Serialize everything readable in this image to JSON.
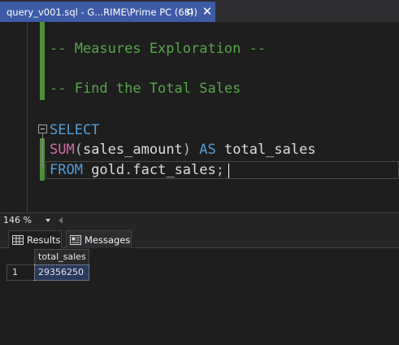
{
  "tab": {
    "title": "query_v001.sql - G...RIME\\Prime PC (68))",
    "pin_icon": "pin-icon",
    "close_icon": "close-icon"
  },
  "editor": {
    "lines": [
      {
        "segments": [
          {
            "text": "-- Measures Exploration --",
            "kind": "comment"
          }
        ]
      },
      {
        "segments": [
          {
            "text": "-- Find the Total Sales",
            "kind": "comment"
          }
        ]
      },
      {
        "segments": [
          {
            "text": "SELECT",
            "kind": "keyword"
          }
        ]
      },
      {
        "segments": [
          {
            "text": "SUM",
            "kind": "function"
          },
          {
            "text": "(",
            "kind": "punct"
          },
          {
            "text": "sales_amount",
            "kind": "identifier"
          },
          {
            "text": ")",
            "kind": "punct"
          },
          {
            "text": " AS ",
            "kind": "keyword"
          },
          {
            "text": "total_sales",
            "kind": "identifier"
          }
        ]
      },
      {
        "segments": [
          {
            "text": "FROM ",
            "kind": "keyword"
          },
          {
            "text": "gold",
            "kind": "identifier"
          },
          {
            "text": ".",
            "kind": "punct"
          },
          {
            "text": "fact_sales",
            "kind": "identifier"
          },
          {
            "text": ";",
            "kind": "punct"
          }
        ]
      }
    ],
    "colors": {
      "comment": "#57a64a",
      "keyword": "#569cd6",
      "function": "#d16ca8",
      "identifier": "#dcdcdc",
      "punct": "#b4b4b4"
    }
  },
  "zoom": {
    "value": "146 %"
  },
  "results": {
    "tabs": [
      {
        "label": "Results",
        "icon": "grid-icon",
        "active": true
      },
      {
        "label": "Messages",
        "icon": "messages-icon",
        "active": false
      }
    ],
    "columns": [
      "total_sales"
    ],
    "rows": [
      {
        "row_number": "1",
        "cells": [
          "29356250"
        ]
      }
    ]
  }
}
